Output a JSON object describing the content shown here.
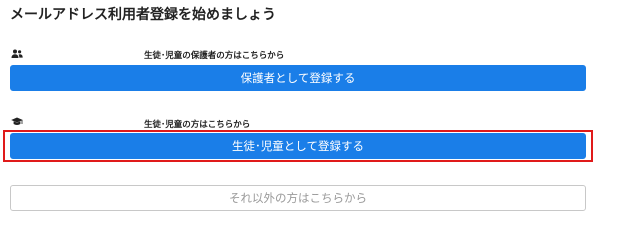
{
  "page": {
    "title": "メールアドレス利用者登録を始めましょう"
  },
  "guardian_section": {
    "icon": "users-icon",
    "label": "生徒･児童の保護者の方はこちらから",
    "button_label": "保護者として登録する",
    "button_color": "#1a7ee8"
  },
  "student_section": {
    "icon": "graduation-cap-icon",
    "label": "生徒･児童の方はこちらから",
    "button_label": "生徒･児童として登録する",
    "button_color": "#1a7ee8"
  },
  "other_section": {
    "button_label": "それ以外の方はこちらから"
  },
  "highlight": {
    "color": "#e01a1a"
  }
}
